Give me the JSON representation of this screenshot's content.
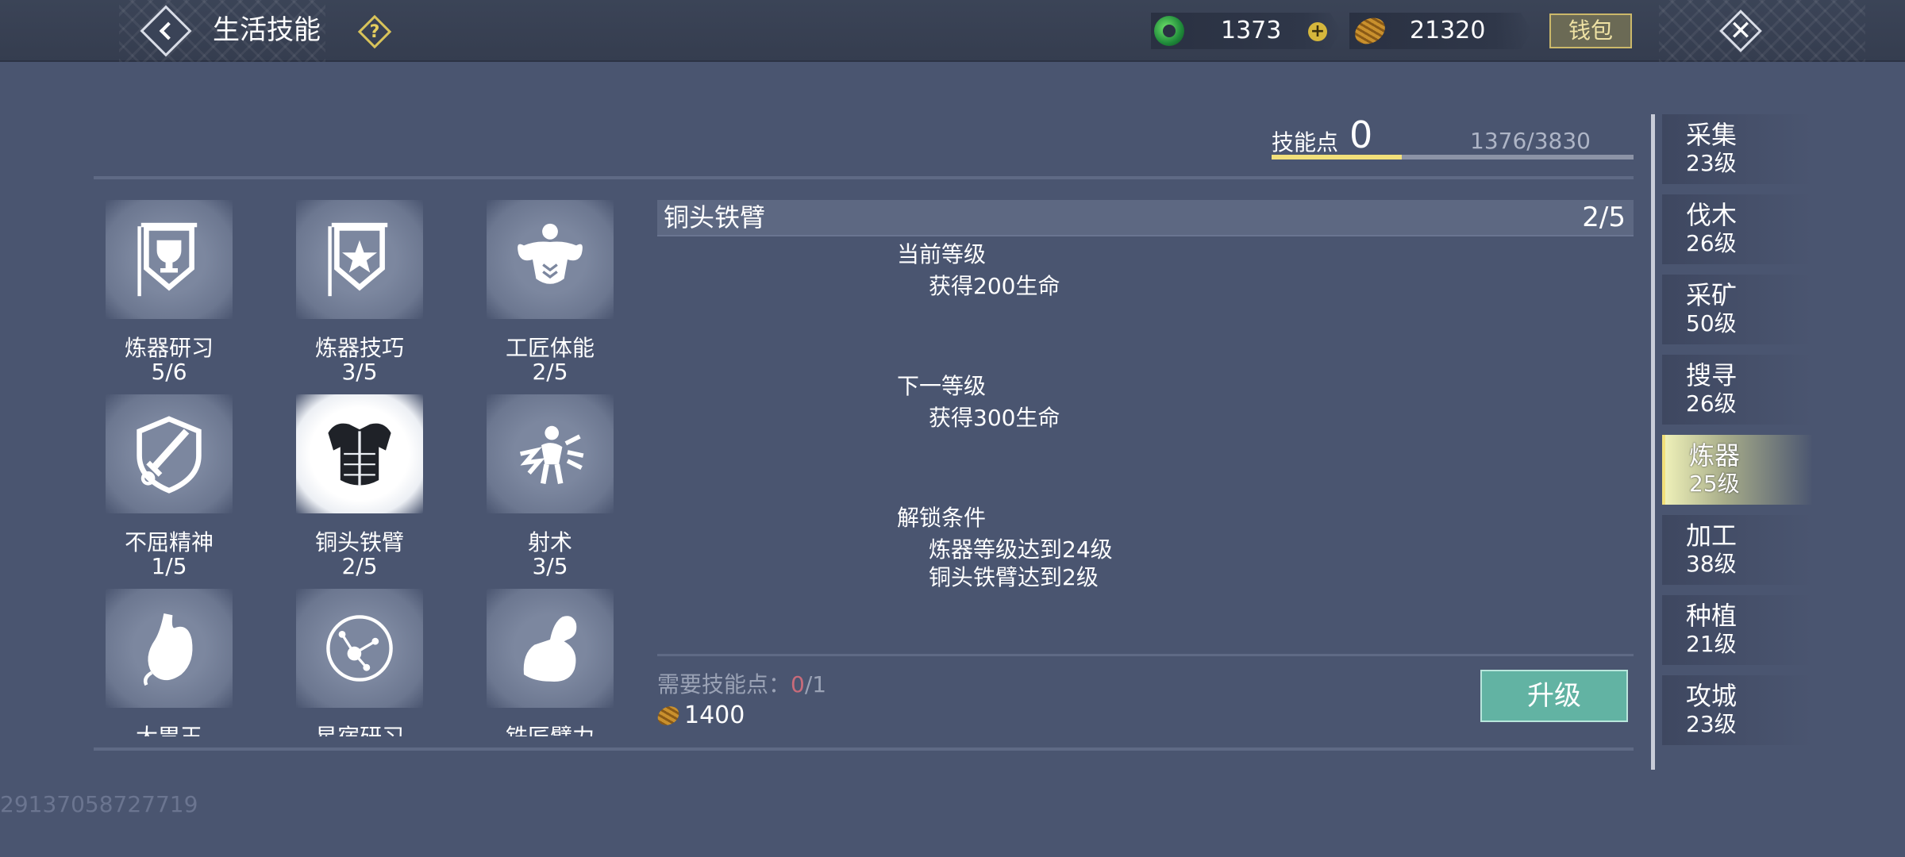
{
  "header": {
    "title": "生活技能",
    "help_icon": "help-question-icon",
    "jade_amount": "1373",
    "gold_amount": "21320",
    "wallet_label": "钱包",
    "close_icon": "close-icon"
  },
  "skill_points": {
    "label": "技能点",
    "value": "0",
    "progress_text": "1376/3830",
    "progress_fraction": 0.36
  },
  "skills": [
    {
      "name": "炼器研习",
      "level": "5/6",
      "icon": "trophy-banner-icon"
    },
    {
      "name": "炼器技巧",
      "level": "3/5",
      "icon": "star-banner-icon"
    },
    {
      "name": "工匠体能",
      "level": "2/5",
      "icon": "muscle-torso-icon"
    },
    {
      "name": "不屈精神",
      "level": "1/5",
      "icon": "shield-sword-icon"
    },
    {
      "name": "铜头铁臂",
      "level": "2/5",
      "icon": "armor-chest-icon",
      "selected": true
    },
    {
      "name": "射术",
      "level": "3/5",
      "icon": "impact-burst-icon"
    },
    {
      "name": "大胃王",
      "level": "",
      "icon": "stomach-icon"
    },
    {
      "name": "星宿研习",
      "level": "",
      "icon": "constellation-icon"
    },
    {
      "name": "铁匠臂力",
      "level": "",
      "icon": "flexed-arm-icon"
    }
  ],
  "detail": {
    "title": "铜头铁臂",
    "level": "2/5",
    "current_label": "当前等级",
    "current_effect": "获得200生命",
    "next_label": "下一等级",
    "next_effect": "获得300生命",
    "unlock_label": "解锁条件",
    "unlock_1": "炼器等级达到24级",
    "unlock_2": "铜头铁臂达到2级",
    "required_label": "需要技能点：",
    "required_have": "0",
    "required_total": "/1",
    "cost": "1400",
    "upgrade_label": "升级"
  },
  "categories": [
    {
      "name": "采集",
      "level": "23级"
    },
    {
      "name": "伐木",
      "level": "26级"
    },
    {
      "name": "采矿",
      "level": "50级"
    },
    {
      "name": "搜寻",
      "level": "26级"
    },
    {
      "name": "炼器",
      "level": "25级",
      "active": true
    },
    {
      "name": "加工",
      "level": "38级"
    },
    {
      "name": "种植",
      "level": "21级"
    },
    {
      "name": "攻城",
      "level": "23级"
    }
  ],
  "uid": "29137058727719",
  "colors": {
    "background": "#4a5570",
    "accent_yellow": "#f2e07a",
    "upgrade_green": "#62b3a3",
    "required_red": "#c86b7a"
  }
}
